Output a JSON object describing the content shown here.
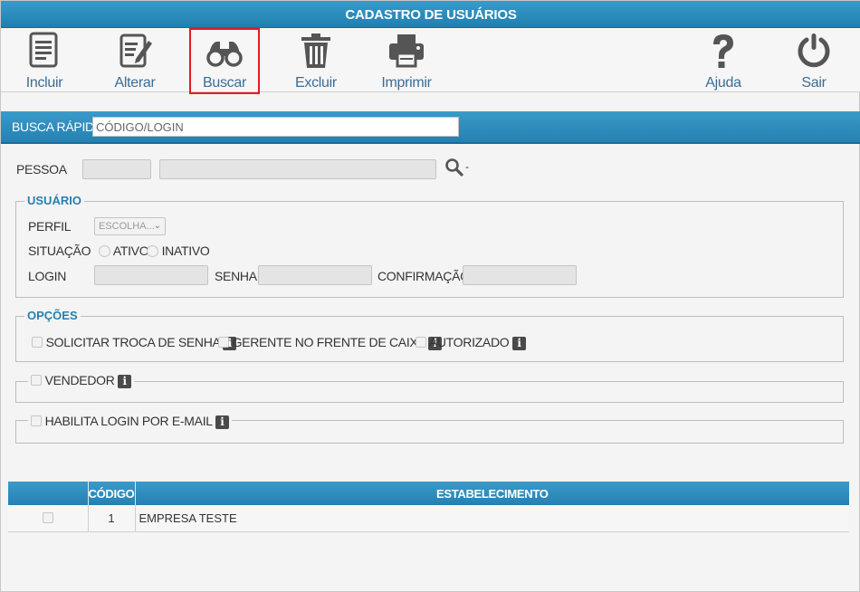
{
  "window": {
    "title": "CADASTRO DE USUÁRIOS"
  },
  "toolbar": {
    "incluir": "Incluir",
    "alterar": "Alterar",
    "buscar": "Buscar",
    "excluir": "Excluir",
    "imprimir": "Imprimir",
    "ajuda": "Ajuda",
    "sair": "Sair"
  },
  "quick_search": {
    "label": "BUSCA RÁPIDA",
    "placeholder": "CÓDIGO/LOGIN"
  },
  "pessoa": {
    "label": "PESSOA",
    "separator": "-"
  },
  "usuario": {
    "legend": "USUÁRIO",
    "perfil_label": "PERFIL",
    "perfil_value": "ESCOLHA...",
    "situacao_label": "SITUAÇÃO",
    "ativo": "ATIVO",
    "inativo": "INATIVO",
    "login_label": "LOGIN",
    "senha_label": "SENHA",
    "confirmacao_label": "CONFIRMAÇÃO"
  },
  "opcoes": {
    "legend": "OPÇÕES",
    "solicitar": "SOLICITAR TROCA DE SENHA",
    "gerente": "GERENTE NO FRENTE DE CAIXA",
    "autorizado": "AUTORIZADO"
  },
  "vendedor": {
    "label": "VENDEDOR"
  },
  "email_login": {
    "label": "HABILITA LOGIN POR E-MAIL"
  },
  "info_glyph": "i",
  "grid": {
    "headers": [
      "",
      "CÓDIGO",
      "ESTABELECIMENTO"
    ],
    "rows": [
      {
        "codigo": "1",
        "estabelecimento": "EMPRESA TESTE"
      }
    ]
  },
  "colors": {
    "accent": "#2581b1",
    "highlight": "#e11b22",
    "toolbar_text": "#3c6c94"
  }
}
